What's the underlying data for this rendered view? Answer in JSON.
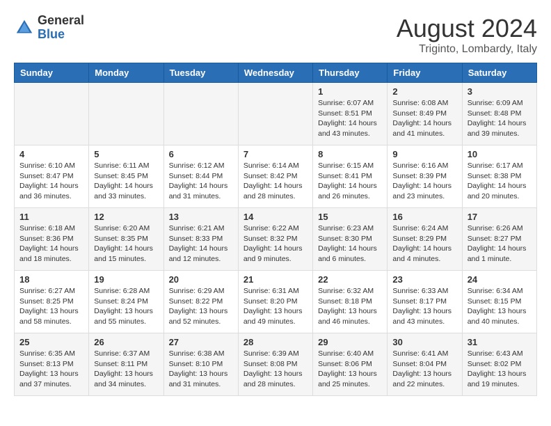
{
  "logo": {
    "general": "General",
    "blue": "Blue"
  },
  "title": "August 2024",
  "location": "Triginto, Lombardy, Italy",
  "days_of_week": [
    "Sunday",
    "Monday",
    "Tuesday",
    "Wednesday",
    "Thursday",
    "Friday",
    "Saturday"
  ],
  "weeks": [
    [
      {
        "day": "",
        "info": ""
      },
      {
        "day": "",
        "info": ""
      },
      {
        "day": "",
        "info": ""
      },
      {
        "day": "",
        "info": ""
      },
      {
        "day": "1",
        "info": "Sunrise: 6:07 AM\nSunset: 8:51 PM\nDaylight: 14 hours and 43 minutes."
      },
      {
        "day": "2",
        "info": "Sunrise: 6:08 AM\nSunset: 8:49 PM\nDaylight: 14 hours and 41 minutes."
      },
      {
        "day": "3",
        "info": "Sunrise: 6:09 AM\nSunset: 8:48 PM\nDaylight: 14 hours and 39 minutes."
      }
    ],
    [
      {
        "day": "4",
        "info": "Sunrise: 6:10 AM\nSunset: 8:47 PM\nDaylight: 14 hours and 36 minutes."
      },
      {
        "day": "5",
        "info": "Sunrise: 6:11 AM\nSunset: 8:45 PM\nDaylight: 14 hours and 33 minutes."
      },
      {
        "day": "6",
        "info": "Sunrise: 6:12 AM\nSunset: 8:44 PM\nDaylight: 14 hours and 31 minutes."
      },
      {
        "day": "7",
        "info": "Sunrise: 6:14 AM\nSunset: 8:42 PM\nDaylight: 14 hours and 28 minutes."
      },
      {
        "day": "8",
        "info": "Sunrise: 6:15 AM\nSunset: 8:41 PM\nDaylight: 14 hours and 26 minutes."
      },
      {
        "day": "9",
        "info": "Sunrise: 6:16 AM\nSunset: 8:39 PM\nDaylight: 14 hours and 23 minutes."
      },
      {
        "day": "10",
        "info": "Sunrise: 6:17 AM\nSunset: 8:38 PM\nDaylight: 14 hours and 20 minutes."
      }
    ],
    [
      {
        "day": "11",
        "info": "Sunrise: 6:18 AM\nSunset: 8:36 PM\nDaylight: 14 hours and 18 minutes."
      },
      {
        "day": "12",
        "info": "Sunrise: 6:20 AM\nSunset: 8:35 PM\nDaylight: 14 hours and 15 minutes."
      },
      {
        "day": "13",
        "info": "Sunrise: 6:21 AM\nSunset: 8:33 PM\nDaylight: 14 hours and 12 minutes."
      },
      {
        "day": "14",
        "info": "Sunrise: 6:22 AM\nSunset: 8:32 PM\nDaylight: 14 hours and 9 minutes."
      },
      {
        "day": "15",
        "info": "Sunrise: 6:23 AM\nSunset: 8:30 PM\nDaylight: 14 hours and 6 minutes."
      },
      {
        "day": "16",
        "info": "Sunrise: 6:24 AM\nSunset: 8:29 PM\nDaylight: 14 hours and 4 minutes."
      },
      {
        "day": "17",
        "info": "Sunrise: 6:26 AM\nSunset: 8:27 PM\nDaylight: 14 hours and 1 minute."
      }
    ],
    [
      {
        "day": "18",
        "info": "Sunrise: 6:27 AM\nSunset: 8:25 PM\nDaylight: 13 hours and 58 minutes."
      },
      {
        "day": "19",
        "info": "Sunrise: 6:28 AM\nSunset: 8:24 PM\nDaylight: 13 hours and 55 minutes."
      },
      {
        "day": "20",
        "info": "Sunrise: 6:29 AM\nSunset: 8:22 PM\nDaylight: 13 hours and 52 minutes."
      },
      {
        "day": "21",
        "info": "Sunrise: 6:31 AM\nSunset: 8:20 PM\nDaylight: 13 hours and 49 minutes."
      },
      {
        "day": "22",
        "info": "Sunrise: 6:32 AM\nSunset: 8:18 PM\nDaylight: 13 hours and 46 minutes."
      },
      {
        "day": "23",
        "info": "Sunrise: 6:33 AM\nSunset: 8:17 PM\nDaylight: 13 hours and 43 minutes."
      },
      {
        "day": "24",
        "info": "Sunrise: 6:34 AM\nSunset: 8:15 PM\nDaylight: 13 hours and 40 minutes."
      }
    ],
    [
      {
        "day": "25",
        "info": "Sunrise: 6:35 AM\nSunset: 8:13 PM\nDaylight: 13 hours and 37 minutes."
      },
      {
        "day": "26",
        "info": "Sunrise: 6:37 AM\nSunset: 8:11 PM\nDaylight: 13 hours and 34 minutes."
      },
      {
        "day": "27",
        "info": "Sunrise: 6:38 AM\nSunset: 8:10 PM\nDaylight: 13 hours and 31 minutes."
      },
      {
        "day": "28",
        "info": "Sunrise: 6:39 AM\nSunset: 8:08 PM\nDaylight: 13 hours and 28 minutes."
      },
      {
        "day": "29",
        "info": "Sunrise: 6:40 AM\nSunset: 8:06 PM\nDaylight: 13 hours and 25 minutes."
      },
      {
        "day": "30",
        "info": "Sunrise: 6:41 AM\nSunset: 8:04 PM\nDaylight: 13 hours and 22 minutes."
      },
      {
        "day": "31",
        "info": "Sunrise: 6:43 AM\nSunset: 8:02 PM\nDaylight: 13 hours and 19 minutes."
      }
    ]
  ]
}
